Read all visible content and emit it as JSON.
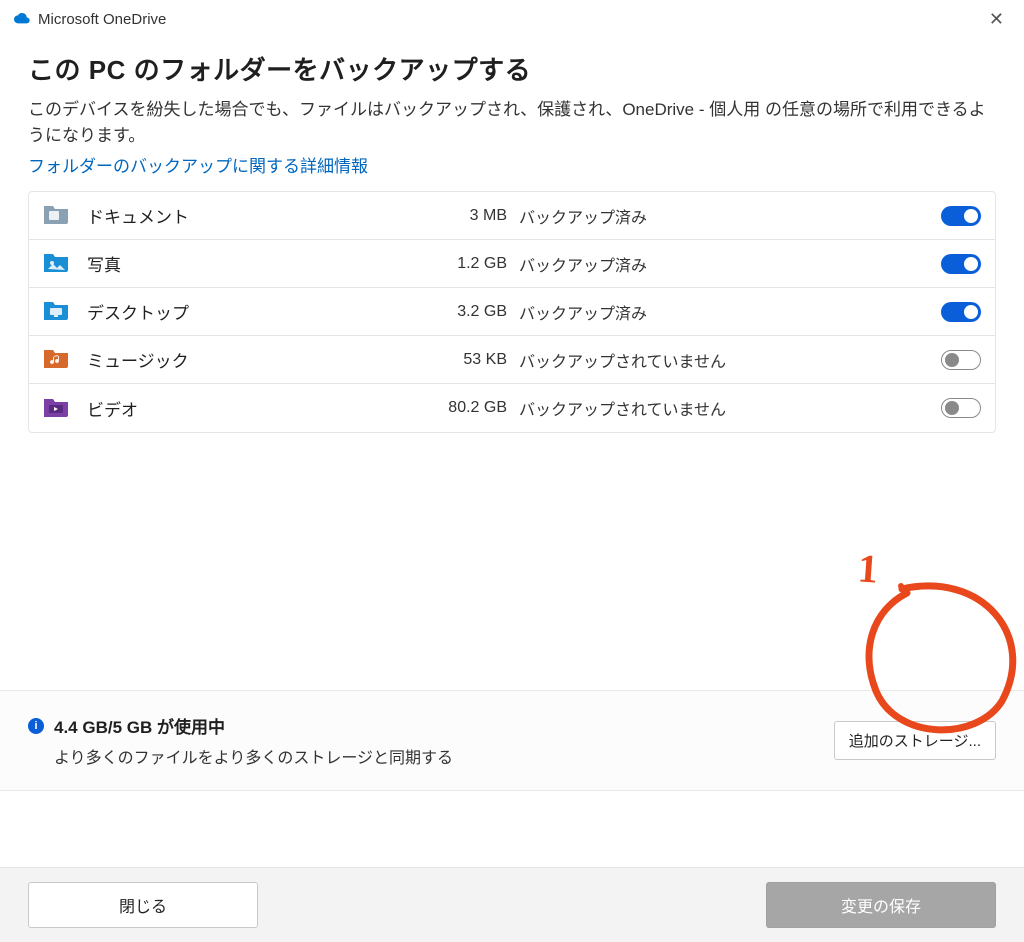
{
  "titlebar": {
    "app_name": "Microsoft OneDrive"
  },
  "heading": "この PC のフォルダーをバックアップする",
  "description": "このデバイスを紛失した場合でも、ファイルはバックアップされ、保護され、OneDrive - 個人用 の任意の場所で利用できるようになります。",
  "link_label": "フォルダーのバックアップに関する詳細情報",
  "folders": [
    {
      "name": "ドキュメント",
      "size": "3 MB",
      "status": "バックアップ済み",
      "on": true,
      "icon": "documents"
    },
    {
      "name": "写真",
      "size": "1.2 GB",
      "status": "バックアップ済み",
      "on": true,
      "icon": "pictures"
    },
    {
      "name": "デスクトップ",
      "size": "3.2 GB",
      "status": "バックアップ済み",
      "on": true,
      "icon": "desktop"
    },
    {
      "name": "ミュージック",
      "size": "53 KB",
      "status": "バックアップされていません",
      "on": false,
      "icon": "music"
    },
    {
      "name": "ビデオ",
      "size": "80.2 GB",
      "status": "バックアップされていません",
      "on": false,
      "icon": "videos"
    }
  ],
  "storage": {
    "title": "4.4 GB/5 GB が使用中",
    "subtitle": "より多くのファイルをより多くのストレージと同期する",
    "button_label": "追加のストレージ..."
  },
  "footer": {
    "close_label": "閉じる",
    "save_label": "変更の保存"
  },
  "annotation": {
    "label": "1"
  },
  "icon_colors": {
    "documents": "#8aa0b3",
    "pictures": "#1b8fd6",
    "desktop": "#1b8fd6",
    "music": "#d66a2c",
    "videos": "#7b3fa6"
  }
}
